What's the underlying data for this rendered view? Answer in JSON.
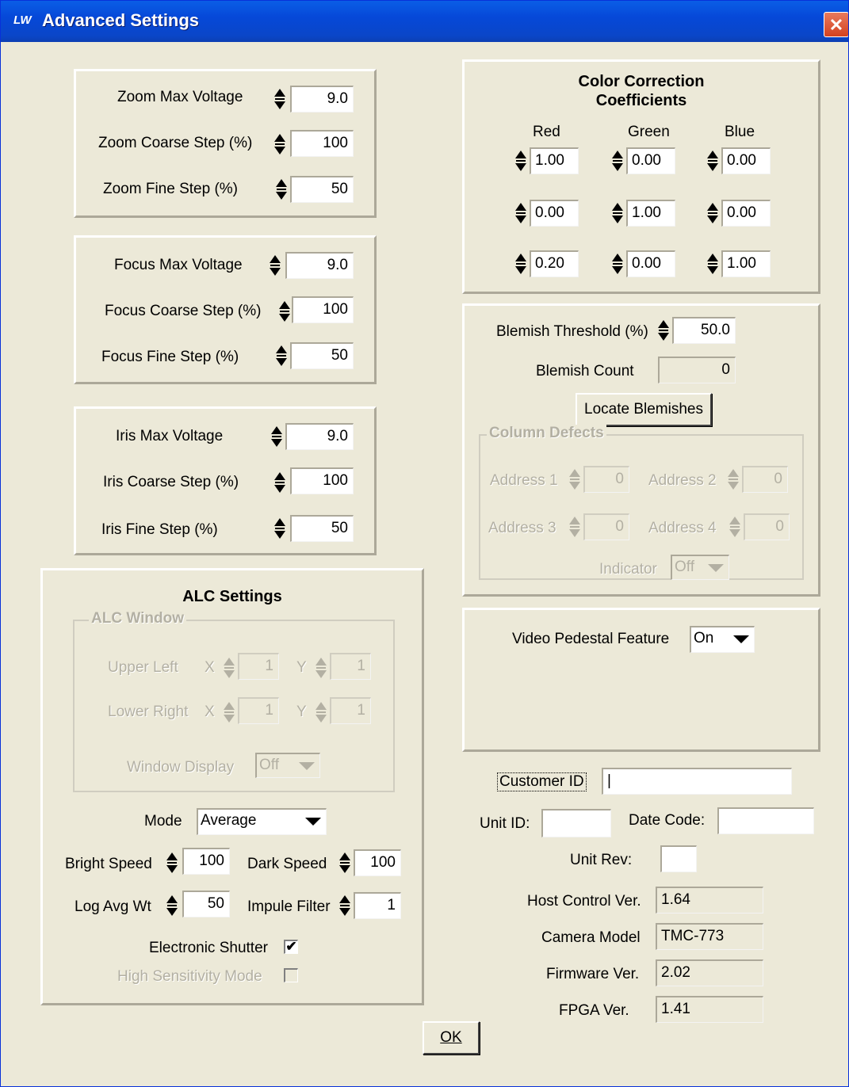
{
  "window": {
    "title": "Advanced Settings",
    "logo_text": "LW",
    "close_glyph": "✕"
  },
  "zoom": {
    "max_voltage": {
      "label": "Zoom Max Voltage",
      "value": "9.0"
    },
    "coarse_step": {
      "label": "Zoom Coarse Step (%)",
      "value": "100"
    },
    "fine_step": {
      "label": "Zoom Fine Step (%)",
      "value": "50"
    }
  },
  "focus": {
    "max_voltage": {
      "label": "Focus Max Voltage",
      "value": "9.0"
    },
    "coarse_step": {
      "label": "Focus Coarse Step (%)",
      "value": "100"
    },
    "fine_step": {
      "label": "Focus Fine Step (%)",
      "value": "50"
    }
  },
  "iris": {
    "max_voltage": {
      "label": "Iris Max Voltage",
      "value": "9.0"
    },
    "coarse_step": {
      "label": "Iris Coarse Step (%)",
      "value": "100"
    },
    "fine_step": {
      "label": "Iris Fine Step (%)",
      "value": "50"
    }
  },
  "color_correction": {
    "title_line1": "Color Correction",
    "title_line2": "Coefficients",
    "headers": [
      "Red",
      "Green",
      "Blue"
    ],
    "matrix": [
      [
        "1.00",
        "0.00",
        "0.00"
      ],
      [
        "0.00",
        "1.00",
        "0.00"
      ],
      [
        "0.20",
        "0.00",
        "1.00"
      ]
    ]
  },
  "blemish": {
    "threshold_label": "Blemish Threshold (%)",
    "threshold_value": "50.0",
    "count_label": "Blemish Count",
    "count_value": "0",
    "locate_button": "Locate Blemishes",
    "column_defects": {
      "title": "Column Defects",
      "address1_label": "Address 1",
      "address1_value": "0",
      "address2_label": "Address 2",
      "address2_value": "0",
      "address3_label": "Address 3",
      "address3_value": "0",
      "address4_label": "Address 4",
      "address4_value": "0",
      "indicator_label": "Indicator",
      "indicator_value": "Off"
    }
  },
  "video_pedestal": {
    "label": "Video Pedestal Feature",
    "value": "On"
  },
  "alc": {
    "title": "ALC Settings",
    "window": {
      "title": "ALC Window",
      "upper_left_label": "Upper Left",
      "upper_left_x_label": "X",
      "upper_left_x": "1",
      "upper_left_y_label": "Y",
      "upper_left_y": "1",
      "lower_right_label": "Lower Right",
      "lower_right_x_label": "X",
      "lower_right_x": "1",
      "lower_right_y_label": "Y",
      "lower_right_y": "1",
      "display_label": "Window Display",
      "display_value": "Off"
    },
    "mode_label": "Mode",
    "mode_value": "Average",
    "bright_speed_label": "Bright Speed",
    "bright_speed_value": "100",
    "dark_speed_label": "Dark Speed",
    "dark_speed_value": "100",
    "log_avg_label": "Log Avg Wt",
    "log_avg_value": "50",
    "impulse_label": "Impule Filter",
    "impulse_value": "1",
    "shutter_label": "Electronic Shutter",
    "shutter_checked": "✔",
    "high_sens_label": "High Sensitivity Mode"
  },
  "info": {
    "customer_id_label": "Customer ID",
    "customer_id_value": "|",
    "unit_id_label": "Unit ID:",
    "unit_id_value": "",
    "date_code_label": "Date Code:",
    "date_code_value": "",
    "unit_rev_label": "Unit Rev:",
    "unit_rev_value": "",
    "host_label": "Host Control Ver.",
    "host_value": "1.64",
    "model_label": "Camera Model",
    "model_value": "TMC-773",
    "firmware_label": "Firmware Ver.",
    "firmware_value": "2.02",
    "fpga_label": "FPGA Ver.",
    "fpga_value": "1.41"
  },
  "ok_button": "OK"
}
